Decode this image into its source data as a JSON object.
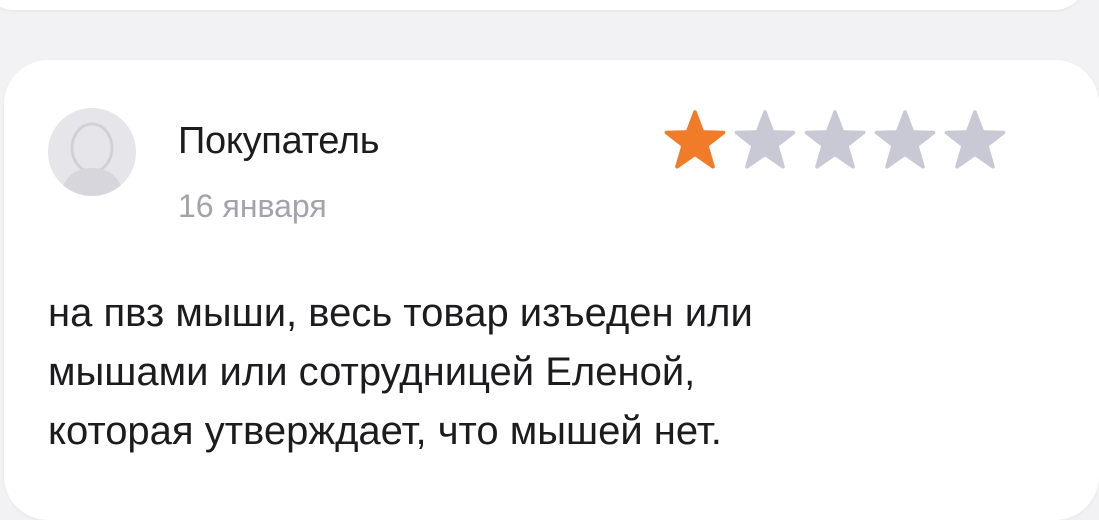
{
  "review": {
    "author": "Покупатель",
    "date": "16 января",
    "rating": 1,
    "max_rating": 5,
    "text_lines": [
      "на пвз мыши, весь товар изъеден или",
      "мышами или сотрудницей Еленой,",
      "которая утверждает, что мышей нет."
    ]
  },
  "colors": {
    "star_filled": "#f07c2a",
    "star_empty": "#c9c9d6",
    "avatar_bg": "#e6e6ea",
    "avatar_fg": "#cfcfd5"
  },
  "icons": {
    "avatar": "user-silhouette-icon",
    "star": "star-icon"
  }
}
